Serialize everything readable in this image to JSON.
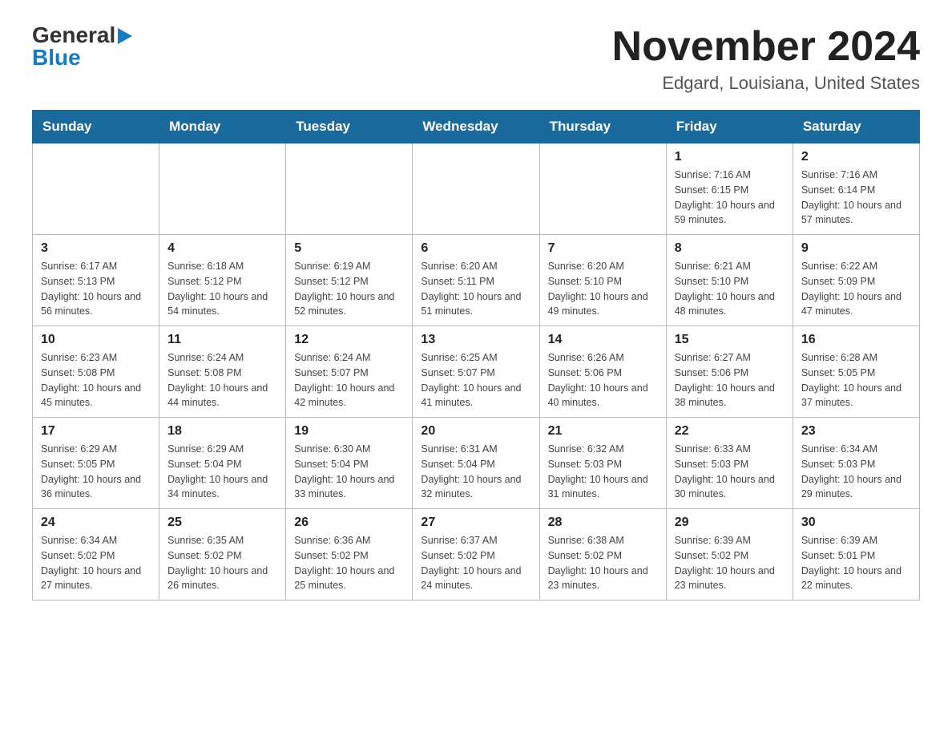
{
  "logo": {
    "general_text": "General",
    "blue_text": "Blue"
  },
  "header": {
    "title": "November 2024",
    "subtitle": "Edgard, Louisiana, United States"
  },
  "days_of_week": [
    "Sunday",
    "Monday",
    "Tuesday",
    "Wednesday",
    "Thursday",
    "Friday",
    "Saturday"
  ],
  "weeks": [
    [
      {
        "day": "",
        "sunrise": "",
        "sunset": "",
        "daylight": ""
      },
      {
        "day": "",
        "sunrise": "",
        "sunset": "",
        "daylight": ""
      },
      {
        "day": "",
        "sunrise": "",
        "sunset": "",
        "daylight": ""
      },
      {
        "day": "",
        "sunrise": "",
        "sunset": "",
        "daylight": ""
      },
      {
        "day": "",
        "sunrise": "",
        "sunset": "",
        "daylight": ""
      },
      {
        "day": "1",
        "sunrise": "Sunrise: 7:16 AM",
        "sunset": "Sunset: 6:15 PM",
        "daylight": "Daylight: 10 hours and 59 minutes."
      },
      {
        "day": "2",
        "sunrise": "Sunrise: 7:16 AM",
        "sunset": "Sunset: 6:14 PM",
        "daylight": "Daylight: 10 hours and 57 minutes."
      }
    ],
    [
      {
        "day": "3",
        "sunrise": "Sunrise: 6:17 AM",
        "sunset": "Sunset: 5:13 PM",
        "daylight": "Daylight: 10 hours and 56 minutes."
      },
      {
        "day": "4",
        "sunrise": "Sunrise: 6:18 AM",
        "sunset": "Sunset: 5:12 PM",
        "daylight": "Daylight: 10 hours and 54 minutes."
      },
      {
        "day": "5",
        "sunrise": "Sunrise: 6:19 AM",
        "sunset": "Sunset: 5:12 PM",
        "daylight": "Daylight: 10 hours and 52 minutes."
      },
      {
        "day": "6",
        "sunrise": "Sunrise: 6:20 AM",
        "sunset": "Sunset: 5:11 PM",
        "daylight": "Daylight: 10 hours and 51 minutes."
      },
      {
        "day": "7",
        "sunrise": "Sunrise: 6:20 AM",
        "sunset": "Sunset: 5:10 PM",
        "daylight": "Daylight: 10 hours and 49 minutes."
      },
      {
        "day": "8",
        "sunrise": "Sunrise: 6:21 AM",
        "sunset": "Sunset: 5:10 PM",
        "daylight": "Daylight: 10 hours and 48 minutes."
      },
      {
        "day": "9",
        "sunrise": "Sunrise: 6:22 AM",
        "sunset": "Sunset: 5:09 PM",
        "daylight": "Daylight: 10 hours and 47 minutes."
      }
    ],
    [
      {
        "day": "10",
        "sunrise": "Sunrise: 6:23 AM",
        "sunset": "Sunset: 5:08 PM",
        "daylight": "Daylight: 10 hours and 45 minutes."
      },
      {
        "day": "11",
        "sunrise": "Sunrise: 6:24 AM",
        "sunset": "Sunset: 5:08 PM",
        "daylight": "Daylight: 10 hours and 44 minutes."
      },
      {
        "day": "12",
        "sunrise": "Sunrise: 6:24 AM",
        "sunset": "Sunset: 5:07 PM",
        "daylight": "Daylight: 10 hours and 42 minutes."
      },
      {
        "day": "13",
        "sunrise": "Sunrise: 6:25 AM",
        "sunset": "Sunset: 5:07 PM",
        "daylight": "Daylight: 10 hours and 41 minutes."
      },
      {
        "day": "14",
        "sunrise": "Sunrise: 6:26 AM",
        "sunset": "Sunset: 5:06 PM",
        "daylight": "Daylight: 10 hours and 40 minutes."
      },
      {
        "day": "15",
        "sunrise": "Sunrise: 6:27 AM",
        "sunset": "Sunset: 5:06 PM",
        "daylight": "Daylight: 10 hours and 38 minutes."
      },
      {
        "day": "16",
        "sunrise": "Sunrise: 6:28 AM",
        "sunset": "Sunset: 5:05 PM",
        "daylight": "Daylight: 10 hours and 37 minutes."
      }
    ],
    [
      {
        "day": "17",
        "sunrise": "Sunrise: 6:29 AM",
        "sunset": "Sunset: 5:05 PM",
        "daylight": "Daylight: 10 hours and 36 minutes."
      },
      {
        "day": "18",
        "sunrise": "Sunrise: 6:29 AM",
        "sunset": "Sunset: 5:04 PM",
        "daylight": "Daylight: 10 hours and 34 minutes."
      },
      {
        "day": "19",
        "sunrise": "Sunrise: 6:30 AM",
        "sunset": "Sunset: 5:04 PM",
        "daylight": "Daylight: 10 hours and 33 minutes."
      },
      {
        "day": "20",
        "sunrise": "Sunrise: 6:31 AM",
        "sunset": "Sunset: 5:04 PM",
        "daylight": "Daylight: 10 hours and 32 minutes."
      },
      {
        "day": "21",
        "sunrise": "Sunrise: 6:32 AM",
        "sunset": "Sunset: 5:03 PM",
        "daylight": "Daylight: 10 hours and 31 minutes."
      },
      {
        "day": "22",
        "sunrise": "Sunrise: 6:33 AM",
        "sunset": "Sunset: 5:03 PM",
        "daylight": "Daylight: 10 hours and 30 minutes."
      },
      {
        "day": "23",
        "sunrise": "Sunrise: 6:34 AM",
        "sunset": "Sunset: 5:03 PM",
        "daylight": "Daylight: 10 hours and 29 minutes."
      }
    ],
    [
      {
        "day": "24",
        "sunrise": "Sunrise: 6:34 AM",
        "sunset": "Sunset: 5:02 PM",
        "daylight": "Daylight: 10 hours and 27 minutes."
      },
      {
        "day": "25",
        "sunrise": "Sunrise: 6:35 AM",
        "sunset": "Sunset: 5:02 PM",
        "daylight": "Daylight: 10 hours and 26 minutes."
      },
      {
        "day": "26",
        "sunrise": "Sunrise: 6:36 AM",
        "sunset": "Sunset: 5:02 PM",
        "daylight": "Daylight: 10 hours and 25 minutes."
      },
      {
        "day": "27",
        "sunrise": "Sunrise: 6:37 AM",
        "sunset": "Sunset: 5:02 PM",
        "daylight": "Daylight: 10 hours and 24 minutes."
      },
      {
        "day": "28",
        "sunrise": "Sunrise: 6:38 AM",
        "sunset": "Sunset: 5:02 PM",
        "daylight": "Daylight: 10 hours and 23 minutes."
      },
      {
        "day": "29",
        "sunrise": "Sunrise: 6:39 AM",
        "sunset": "Sunset: 5:02 PM",
        "daylight": "Daylight: 10 hours and 23 minutes."
      },
      {
        "day": "30",
        "sunrise": "Sunrise: 6:39 AM",
        "sunset": "Sunset: 5:01 PM",
        "daylight": "Daylight: 10 hours and 22 minutes."
      }
    ]
  ]
}
